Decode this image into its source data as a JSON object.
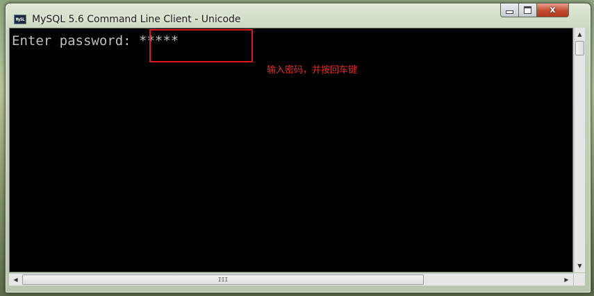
{
  "window": {
    "title": "MySQL 5.6 Command Line Client - Unicode",
    "icon": "console-app-icon",
    "icon_text": "My5L",
    "controls": {
      "minimize": "minimize-icon",
      "maximize": "maximize-icon",
      "close": "close-icon",
      "close_glyph": "x"
    }
  },
  "console": {
    "prompt": "Enter password: ",
    "password_mask": "*****"
  },
  "annotation": {
    "text": "输入密码，并按回车键",
    "color": "#e0171c"
  },
  "scrollbars": {
    "up_glyph": "▲",
    "down_glyph": "▼",
    "left_glyph": "◀",
    "right_glyph": "▶",
    "h_thumb_grip": "III"
  },
  "colors": {
    "console_background": "#000000",
    "console_text": "#c0c0c0",
    "close_button": "#c44b2e"
  }
}
